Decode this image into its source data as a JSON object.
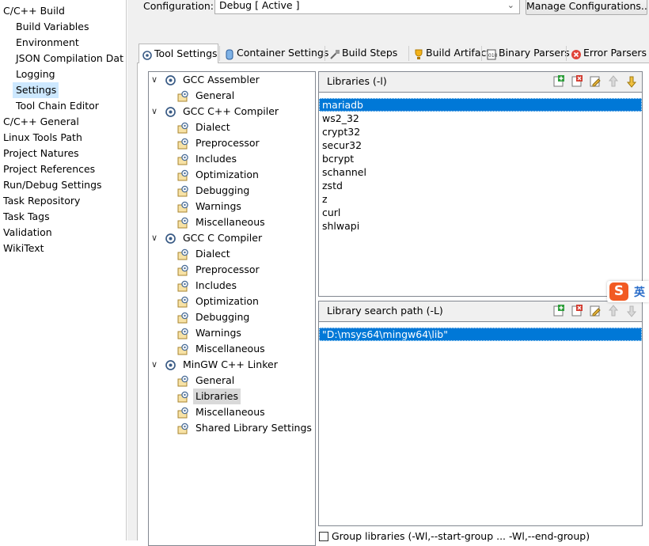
{
  "left_nav": {
    "items": [
      {
        "label": "C/C++ Build",
        "indent": 0,
        "selected": false
      },
      {
        "label": "Build Variables",
        "indent": 1,
        "selected": false
      },
      {
        "label": "Environment",
        "indent": 1,
        "selected": false
      },
      {
        "label": "JSON Compilation Dat",
        "indent": 1,
        "selected": false
      },
      {
        "label": "Logging",
        "indent": 1,
        "selected": false
      },
      {
        "label": "Settings",
        "indent": 1,
        "selected": true
      },
      {
        "label": "Tool Chain Editor",
        "indent": 1,
        "selected": false
      },
      {
        "label": "C/C++ General",
        "indent": 0,
        "selected": false
      },
      {
        "label": "Linux Tools Path",
        "indent": 0,
        "selected": false
      },
      {
        "label": "Project Natures",
        "indent": 0,
        "selected": false
      },
      {
        "label": "Project References",
        "indent": 0,
        "selected": false
      },
      {
        "label": "Run/Debug Settings",
        "indent": 0,
        "selected": false
      },
      {
        "label": "Task Repository",
        "indent": 0,
        "selected": false
      },
      {
        "label": "Task Tags",
        "indent": 0,
        "selected": false
      },
      {
        "label": "Validation",
        "indent": 0,
        "selected": false
      },
      {
        "label": "WikiText",
        "indent": 0,
        "selected": false
      }
    ]
  },
  "config": {
    "label": "Configuration:",
    "value": "Debug  [ Active ]",
    "manage_label": "Manage Configurations..."
  },
  "tabs": [
    {
      "label": "Tool Settings",
      "icon": "tool-settings-icon",
      "active": true
    },
    {
      "label": "Container Settings",
      "icon": "container-icon",
      "active": false
    },
    {
      "label": "Build Steps",
      "icon": "build-steps-icon",
      "active": false
    },
    {
      "label": "Build Artifact",
      "icon": "trophy-icon",
      "active": false
    },
    {
      "label": "Binary Parsers",
      "icon": "binary-parser-icon",
      "active": false
    },
    {
      "label": "Error Parsers",
      "icon": "error-icon",
      "active": false
    }
  ],
  "tree": [
    {
      "label": "GCC Assembler",
      "level": 0,
      "expanded": true,
      "selected": false
    },
    {
      "label": "General",
      "level": 1,
      "selected": false
    },
    {
      "label": "GCC C++ Compiler",
      "level": 0,
      "expanded": true,
      "selected": false
    },
    {
      "label": "Dialect",
      "level": 1,
      "selected": false
    },
    {
      "label": "Preprocessor",
      "level": 1,
      "selected": false
    },
    {
      "label": "Includes",
      "level": 1,
      "selected": false
    },
    {
      "label": "Optimization",
      "level": 1,
      "selected": false
    },
    {
      "label": "Debugging",
      "level": 1,
      "selected": false
    },
    {
      "label": "Warnings",
      "level": 1,
      "selected": false
    },
    {
      "label": "Miscellaneous",
      "level": 1,
      "selected": false
    },
    {
      "label": "GCC C Compiler",
      "level": 0,
      "expanded": true,
      "selected": false
    },
    {
      "label": "Dialect",
      "level": 1,
      "selected": false
    },
    {
      "label": "Preprocessor",
      "level": 1,
      "selected": false
    },
    {
      "label": "Includes",
      "level": 1,
      "selected": false
    },
    {
      "label": "Optimization",
      "level": 1,
      "selected": false
    },
    {
      "label": "Debugging",
      "level": 1,
      "selected": false
    },
    {
      "label": "Warnings",
      "level": 1,
      "selected": false
    },
    {
      "label": "Miscellaneous",
      "level": 1,
      "selected": false
    },
    {
      "label": "MinGW C++ Linker",
      "level": 0,
      "expanded": true,
      "selected": false
    },
    {
      "label": "General",
      "level": 1,
      "selected": false
    },
    {
      "label": "Libraries",
      "level": 1,
      "selected": true
    },
    {
      "label": "Miscellaneous",
      "level": 1,
      "selected": false
    },
    {
      "label": "Shared Library Settings",
      "level": 1,
      "selected": false
    }
  ],
  "libraries": {
    "title": "Libraries (-l)",
    "items": [
      "mariadb",
      "ws2_32",
      "crypt32",
      "secur32",
      "bcrypt",
      "schannel",
      "zstd",
      "z",
      "curl",
      "shlwapi"
    ],
    "selected_index": 0
  },
  "search_path": {
    "title": "Library search path (-L)",
    "items": [
      "\"D:\\msys64\\mingw64\\lib\""
    ],
    "selected_index": 0
  },
  "group_libraries_label": "Group libraries (-Wl,--start-group  ...  -Wl,--end-group)",
  "ime": {
    "logo": "S",
    "mode": "英"
  },
  "colors": {
    "selection": "#0078d7",
    "nav_selected": "#cde8ff",
    "panel_bg": "#f0f0f0"
  }
}
